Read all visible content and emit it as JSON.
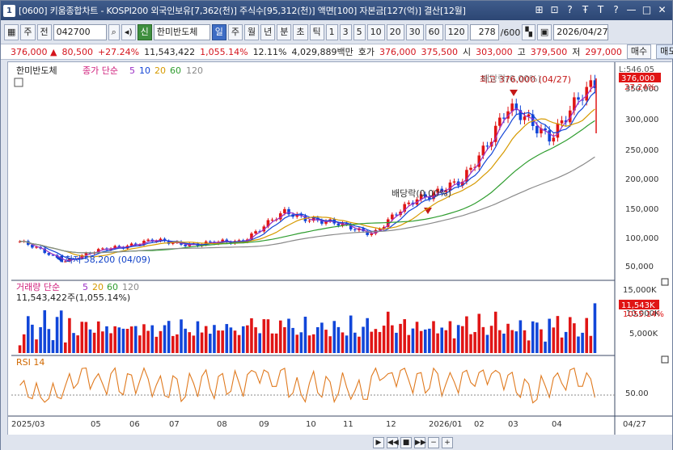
{
  "window": {
    "screen_no": "1",
    "title": "[0600] 키움종합차트 - KOSPI200 외국인보유[7,362(천)] 주식수[95,312(천)] 액면[100] 자본금[127(억)] 결산[12월]",
    "title_buttons": [
      "⊞",
      "⊡",
      "?",
      "Ŧ",
      "T",
      "?",
      "—",
      "□",
      "✕"
    ]
  },
  "toolbar": {
    "mode_a": "주",
    "mode_b": "전",
    "stock_code": "042700",
    "stock_name": "한미반도체",
    "badge": "신",
    "periods": [
      "일",
      "주",
      "월",
      "년",
      "분",
      "초",
      "틱"
    ],
    "active_period": "일",
    "intervals": [
      "1",
      "3",
      "5",
      "10",
      "20",
      "30",
      "60",
      "120"
    ],
    "count": "278",
    "count_max": "/600",
    "date": "2026/04/27"
  },
  "quote": {
    "price": "376,000",
    "change": "80,500",
    "change_pct": "+27.24%",
    "volume": "11,543,422",
    "volume_pct": "1,055.14%",
    "turnover_pct": "12.11%",
    "amount": "4,029,889백만",
    "bid_label": "호가",
    "bid": "376,000",
    "ask": "375,500",
    "open_label": "시",
    "open": "303,000",
    "high_label": "고",
    "high": "379,500",
    "low_label": "저",
    "low": "297,000",
    "buy_label": "매수",
    "sell_label": "매도"
  },
  "price_panel": {
    "name": "한미반도체",
    "legend_title": "종가 단순",
    "ma_periods": [
      "5",
      "10",
      "20",
      "60",
      "120"
    ],
    "ma_colors": [
      "#9b2ec4",
      "#1244d6",
      "#d69a00",
      "#2f9d2f",
      "#8a8a8a"
    ],
    "yaxis": [
      "350,000",
      "300,000",
      "250,000",
      "200,000",
      "150,000",
      "100,000",
      "50,000"
    ],
    "top_label": "L:546.05",
    "price_tag": "376,000",
    "pct_tag": "27.24%",
    "high_label": "최고 376,000 (04/27)",
    "low_label": "최저 58,200 (04/09)",
    "dividend_label_1": "배당락(0.00%)",
    "dividend_label_2": "배당락(0.00%)"
  },
  "volume_panel": {
    "legend": "거래량 단순",
    "ma_periods": [
      "5",
      "20",
      "60",
      "120"
    ],
    "ma_colors": [
      "#9b2ec4",
      "#d69a00",
      "#2f9d2f",
      "#8a8a8a"
    ],
    "value_text": "11,543,422주(1,055.14%)",
    "yaxis": [
      "15,000K",
      "10,000K",
      "5,000K"
    ],
    "tag": "11,543K",
    "tag_pct": "1055.14%"
  },
  "rsi_panel": {
    "legend": "RSI 14",
    "yaxis": [
      "50.00"
    ]
  },
  "xaxis": [
    "2025/03",
    "05",
    "06",
    "07",
    "08",
    "09",
    "10",
    "11",
    "12",
    "2026/01",
    "02",
    "03",
    "04",
    "04/27"
  ],
  "chart_data": {
    "type": "candlestick",
    "x": [
      "2025/03",
      "05",
      "06",
      "07",
      "08",
      "09",
      "10",
      "11",
      "12",
      "2026/01",
      "02",
      "03",
      "04",
      "04/27"
    ],
    "close_approx": [
      97000,
      63000,
      85000,
      98000,
      92000,
      98000,
      148000,
      130000,
      112000,
      175000,
      200000,
      330000,
      285000,
      376000
    ],
    "ylim": [
      40000,
      390000
    ],
    "colors": {
      "up": "#e01515",
      "down": "#1146d9"
    }
  }
}
